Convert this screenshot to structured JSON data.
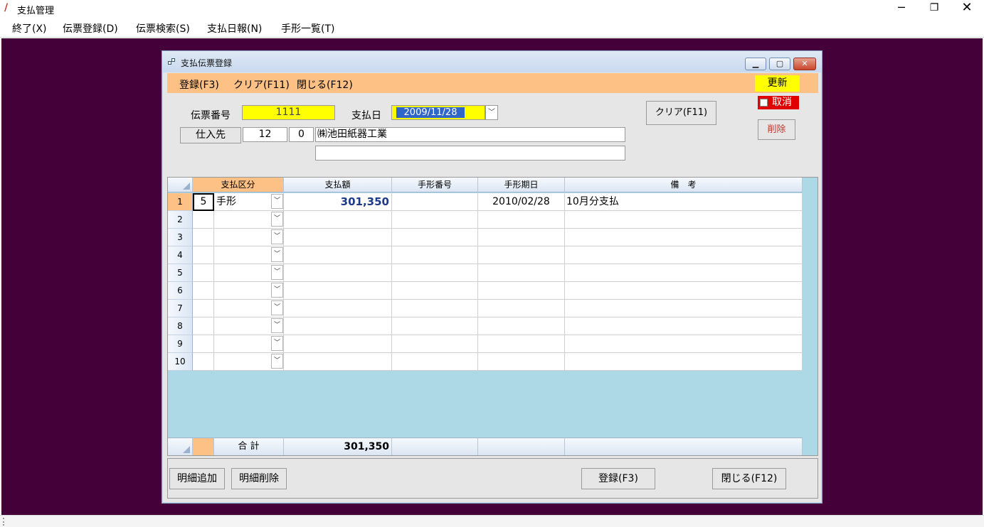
{
  "app": {
    "title": "支払管理",
    "controls": {
      "minimize": "─",
      "maximize": "❐",
      "close": "✕"
    }
  },
  "menu": {
    "items": [
      "終了(X)",
      "伝票登録(D)",
      "伝票検索(S)",
      "支払日報(N)",
      "手形一覧(T)"
    ]
  },
  "child": {
    "title": "支払伝票登録",
    "controls": {
      "minimize": "▁",
      "restore": "▢",
      "close": "✕"
    },
    "menu": [
      "登録(F3)",
      "クリア(F11)",
      "閉じる(F12)"
    ],
    "update_badge": "更新",
    "cancel_label": "取消",
    "form": {
      "voucher_no_label": "伝票番号",
      "voucher_no_value": "1111",
      "pay_date_label": "支払日",
      "pay_date_value": "2009/11/28",
      "supplier_button": "仕入先",
      "supplier_code": "12",
      "supplier_branch": "0",
      "supplier_name": "㈱池田紙器工業",
      "supplier_name2": "",
      "clear_button": "クリア(F11)",
      "delete_button": "削除"
    },
    "grid": {
      "columns": [
        "支払区分",
        "支払額",
        "手形番号",
        "手形期日",
        "備　考"
      ],
      "rows": [
        {
          "no": "1",
          "code": "5",
          "type": "手形",
          "amount": "301,350",
          "bill_no": "",
          "due": "2010/02/28",
          "remarks": "10月分支払"
        },
        {
          "no": "2",
          "code": "",
          "type": "",
          "amount": "",
          "bill_no": "",
          "due": "",
          "remarks": ""
        },
        {
          "no": "3",
          "code": "",
          "type": "",
          "amount": "",
          "bill_no": "",
          "due": "",
          "remarks": ""
        },
        {
          "no": "4",
          "code": "",
          "type": "",
          "amount": "",
          "bill_no": "",
          "due": "",
          "remarks": ""
        },
        {
          "no": "5",
          "code": "",
          "type": "",
          "amount": "",
          "bill_no": "",
          "due": "",
          "remarks": ""
        },
        {
          "no": "6",
          "code": "",
          "type": "",
          "amount": "",
          "bill_no": "",
          "due": "",
          "remarks": ""
        },
        {
          "no": "7",
          "code": "",
          "type": "",
          "amount": "",
          "bill_no": "",
          "due": "",
          "remarks": ""
        },
        {
          "no": "8",
          "code": "",
          "type": "",
          "amount": "",
          "bill_no": "",
          "due": "",
          "remarks": ""
        },
        {
          "no": "9",
          "code": "",
          "type": "",
          "amount": "",
          "bill_no": "",
          "due": "",
          "remarks": ""
        },
        {
          "no": "10",
          "code": "",
          "type": "",
          "amount": "",
          "bill_no": "",
          "due": "",
          "remarks": ""
        }
      ],
      "total_label": "合 計",
      "total_amount": "301,350"
    },
    "buttons": {
      "add_line": "明細追加",
      "delete_line": "明細削除",
      "register": "登録(F3)",
      "close": "閉じる(F12)"
    },
    "colors": {
      "mdi_background": "#440038",
      "menu_accent": "#fdc185",
      "highlight_yellow": "#ffff00",
      "cancel_red": "#e00000",
      "grid_background": "#add8e6"
    }
  }
}
